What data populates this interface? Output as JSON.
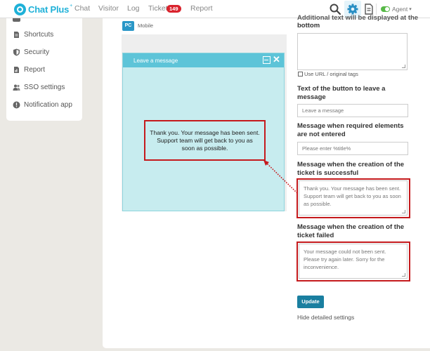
{
  "app": {
    "logo_text": "Chat Plus",
    "logo_sup": "+",
    "brand_color": "#1fb1d8"
  },
  "topnav": {
    "items": [
      "Chat",
      "Visitor",
      "Log",
      "Ticket",
      "Report"
    ],
    "ticket_badge": "149",
    "agent_label": "Agent",
    "agent_status_color": "#57b947"
  },
  "sidebar": {
    "items": [
      {
        "label": "Shortcuts",
        "icon": "file-icon"
      },
      {
        "label": "Security",
        "icon": "shield-icon"
      },
      {
        "label": "Report",
        "icon": "report-icon"
      },
      {
        "label": "SSO settings",
        "icon": "users-icon"
      },
      {
        "label": "Notification app",
        "icon": "info-icon"
      }
    ]
  },
  "preview": {
    "pc_label": "PC",
    "mobile_label": "Mobile",
    "widget_title": "Leave a message",
    "callout_text": "Thank you. Your message has been sent. Support team will get back to you as soon as possible."
  },
  "form": {
    "cut_heading": "Additional text will be displayed at the",
    "cut_heading_2": "bottom",
    "use_url_label": "Use URL / original tags",
    "button_text_heading": "Text of the button to leave a message",
    "button_text_placeholder": "Leave a message",
    "required_heading": "Message when required elements are not entered",
    "required_placeholder": "Please enter %title%",
    "success_heading": "Message when the creation of the ticket is successful",
    "success_text": "Thank you. Your message has been sent. Support team will get back to you as soon as possible.",
    "failed_heading": "Message when the creation of the ticket failed",
    "failed_text": "Your message could not been sent. Please try again later. Sorry for the inconvenience.",
    "update_label": "Update",
    "hide_settings_label": "Hide detailed settings",
    "highlight_color": "#c51a1d"
  }
}
